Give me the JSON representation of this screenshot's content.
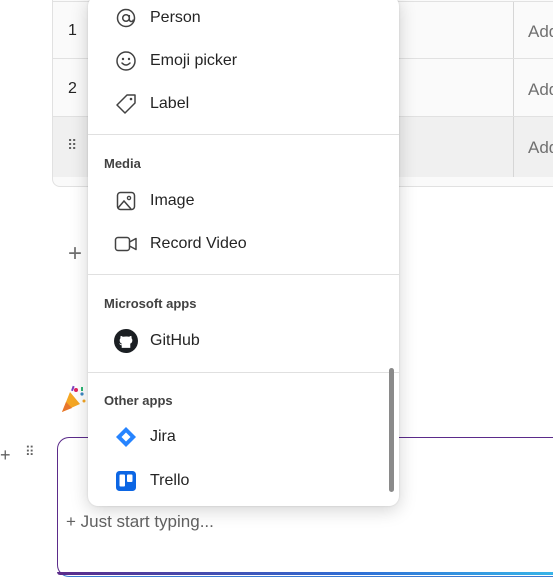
{
  "table": {
    "rows": [
      {
        "num": "1",
        "add": "Add"
      },
      {
        "num": "2",
        "add": "Add"
      },
      {
        "drag": "⠿",
        "add": "Add"
      }
    ]
  },
  "menu": {
    "items_top": [
      {
        "label": "Person",
        "icon": "at-icon"
      },
      {
        "label": "Emoji picker",
        "icon": "emoji-icon"
      },
      {
        "label": "Label",
        "icon": "tag-icon"
      }
    ],
    "sections": [
      {
        "title": "Media",
        "items": [
          {
            "label": "Image",
            "icon": "image-icon"
          },
          {
            "label": "Record Video",
            "icon": "video-icon"
          }
        ]
      },
      {
        "title": "Microsoft apps",
        "items": [
          {
            "label": "GitHub",
            "icon": "github-icon"
          }
        ]
      },
      {
        "title": "Other apps",
        "items": [
          {
            "label": "Jira",
            "icon": "jira-icon"
          },
          {
            "label": "Trello",
            "icon": "trello-icon"
          }
        ]
      }
    ]
  },
  "card": {
    "hint": "+ Just start typing..."
  },
  "colors": {
    "accent_purple": "#5b2b8a",
    "jira_blue": "#2684ff",
    "trello_blue": "#0c66e4"
  }
}
